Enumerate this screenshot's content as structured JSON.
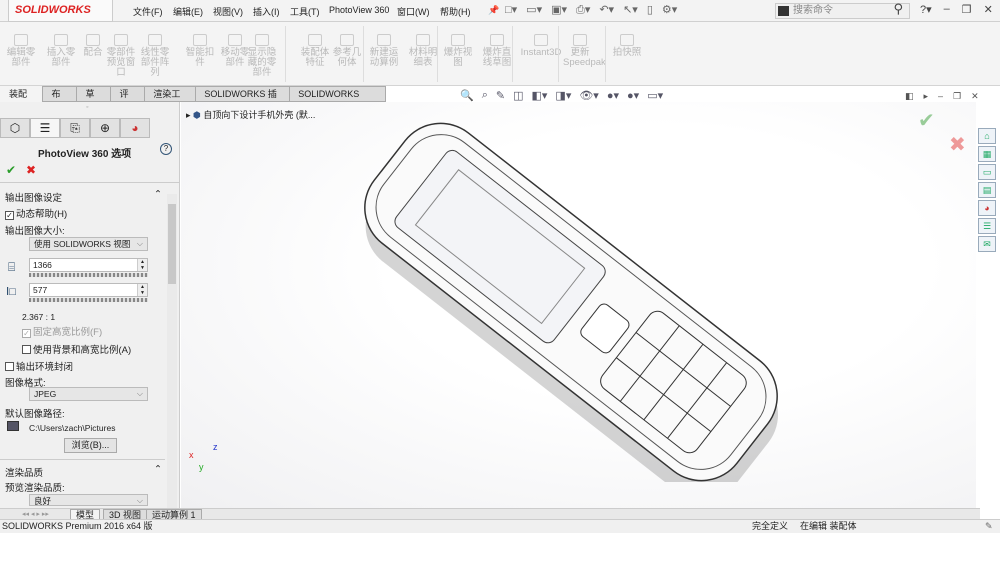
{
  "app": {
    "logo": "SOLIDWORKS"
  },
  "menu": [
    "文件(F)",
    "编辑(E)",
    "视图(V)",
    "插入(I)",
    "工具(T)",
    "PhotoView 360",
    "窗口(W)",
    "帮助(H)"
  ],
  "search": {
    "placeholder": "搜索命令"
  },
  "ribbon": [
    "编辑零部件",
    "插入零部件",
    "配合",
    "零部件预览窗口",
    "线性零部件阵列",
    "智能扣件",
    "移动零部件",
    "显示隐藏的零部件",
    "装配体特征",
    "参考几何体",
    "新建运动算例",
    "材料明细表",
    "爆炸视图",
    "爆炸直线草图",
    "Instant3D",
    "更新Speedpak",
    "拍快照"
  ],
  "tabs": [
    "装配体",
    "布局",
    "草图",
    "评估",
    "渲染工具",
    "SOLIDWORKS 插件",
    "SOLIDWORKS MBD"
  ],
  "tree": {
    "root": "自顶向下设计手机外壳 (默..."
  },
  "panel": {
    "title": "PhotoView 360 选项",
    "section1": "输出图像设定",
    "dynamic_help": "动态帮助(H)",
    "size_label": "输出图像大小:",
    "size_option": "使用 SOLIDWORKS 视图",
    "width": "1366",
    "height": "577",
    "ratio": "2.367 : 1",
    "fixed_ratio": "固定高宽比例(F)",
    "use_bg_ratio": "使用背景和高宽比例(A)",
    "output_env": "输出环境封闭",
    "format_label": "图像格式:",
    "format": "JPEG",
    "path_label": "默认图像路径:",
    "path": "C:\\Users\\zach\\Pictures",
    "browse": "浏览(B)...",
    "section2": "渲染品质",
    "preview_quality_label": "预览渲染品质:",
    "preview_quality": "良好"
  },
  "bottom_tabs": [
    "模型",
    "3D 视图",
    "运动算例 1"
  ],
  "status": {
    "left": "SOLIDWORKS Premium 2016 x64 版",
    "right1": "完全定义",
    "right2": "在编辑 装配体"
  },
  "colors": {
    "accent": "#d22222",
    "ok": "#2a9d2a"
  }
}
